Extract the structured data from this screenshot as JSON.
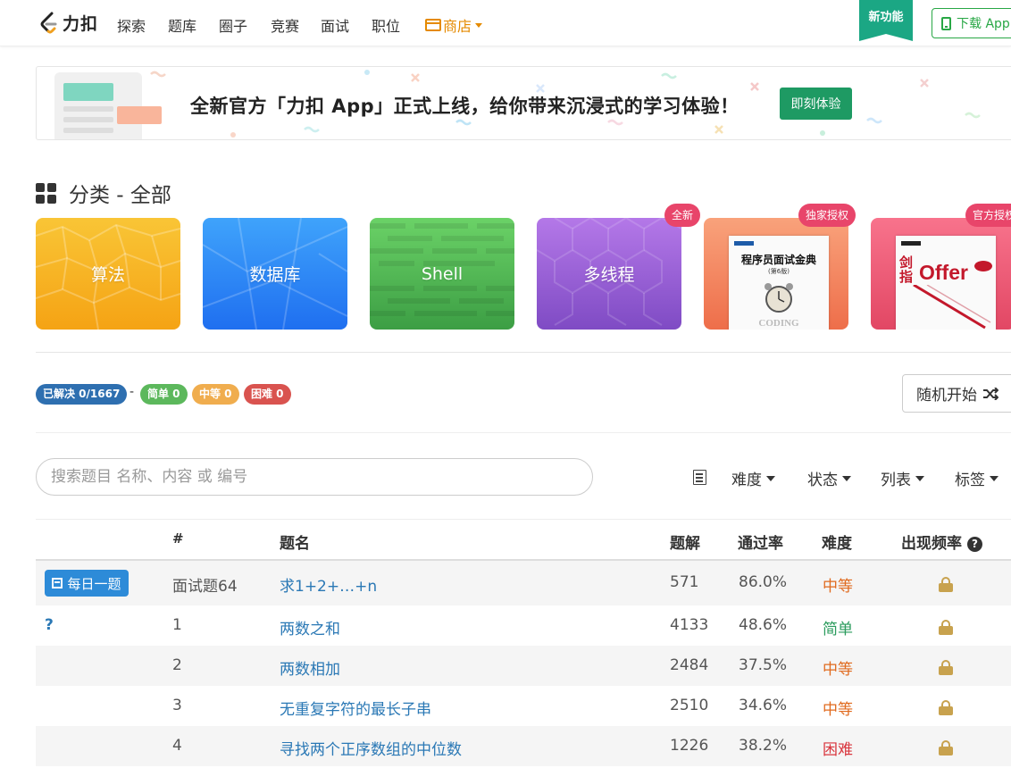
{
  "nav": {
    "logo_text": "力扣",
    "items": [
      "探索",
      "题库",
      "圈子",
      "竞赛",
      "面试",
      "职位"
    ],
    "store_label": "商店",
    "new_feature_label": "新功能",
    "download_label": "下载 App"
  },
  "banner": {
    "text": "全新官方「力扣 App」正式上线，给你带来沉浸式的学习体验！",
    "button_label": "即刻体验"
  },
  "categories": {
    "title": "分类 - 全部",
    "cards": [
      {
        "label": "算法",
        "color": "#f7b21a"
      },
      {
        "label": "数据库",
        "color": "#2f8cf5"
      },
      {
        "label": "Shell",
        "color": "#54ba5a"
      },
      {
        "label": "多线程",
        "color": "#9f67d9",
        "tag": "全新"
      },
      {
        "label": "程序员面试金典",
        "tag": "独家授权",
        "book_subtitle": "(第6版)"
      },
      {
        "label": "剑指 Offer",
        "tag": "官方授权"
      }
    ]
  },
  "progress": {
    "solved": "已解决 0/1667",
    "dash": "-",
    "easy": "简单 0",
    "medium": "中等 0",
    "hard": "困难 0",
    "random_label": "随机开始"
  },
  "search": {
    "placeholder": "搜索题目 名称、内容 或 编号"
  },
  "filters": [
    "难度",
    "状态",
    "列表",
    "标签"
  ],
  "table": {
    "headers": {
      "num": "#",
      "title": "题名",
      "solutions": "题解",
      "acceptance": "通过率",
      "difficulty": "难度",
      "frequency": "出现频率"
    },
    "daily_label": "每日一题",
    "rows": [
      {
        "num": "面试题64",
        "title": "求1+2+…+n",
        "solutions": "571",
        "acceptance": "86.0%",
        "difficulty": "中等",
        "level": "mid",
        "daily": true
      },
      {
        "num": "1",
        "title": "两数之和",
        "solutions": "4133",
        "acceptance": "48.6%",
        "difficulty": "简单",
        "level": "easy",
        "mark": "?"
      },
      {
        "num": "2",
        "title": "两数相加",
        "solutions": "2484",
        "acceptance": "37.5%",
        "difficulty": "中等",
        "level": "mid"
      },
      {
        "num": "3",
        "title": "无重复字符的最长子串",
        "solutions": "2510",
        "acceptance": "34.6%",
        "difficulty": "中等",
        "level": "mid"
      },
      {
        "num": "4",
        "title": "寻找两个正序数组的中位数",
        "solutions": "1226",
        "acceptance": "38.2%",
        "difficulty": "困难",
        "level": "hard"
      }
    ]
  },
  "colors": {
    "accent_green": "#1ba784",
    "link_blue": "#2a78b5",
    "solved_badge": "#2e6fb0",
    "easy_badge": "#5cb85c",
    "medium_badge": "#f0ad4e",
    "hard_badge": "#d9534f"
  }
}
